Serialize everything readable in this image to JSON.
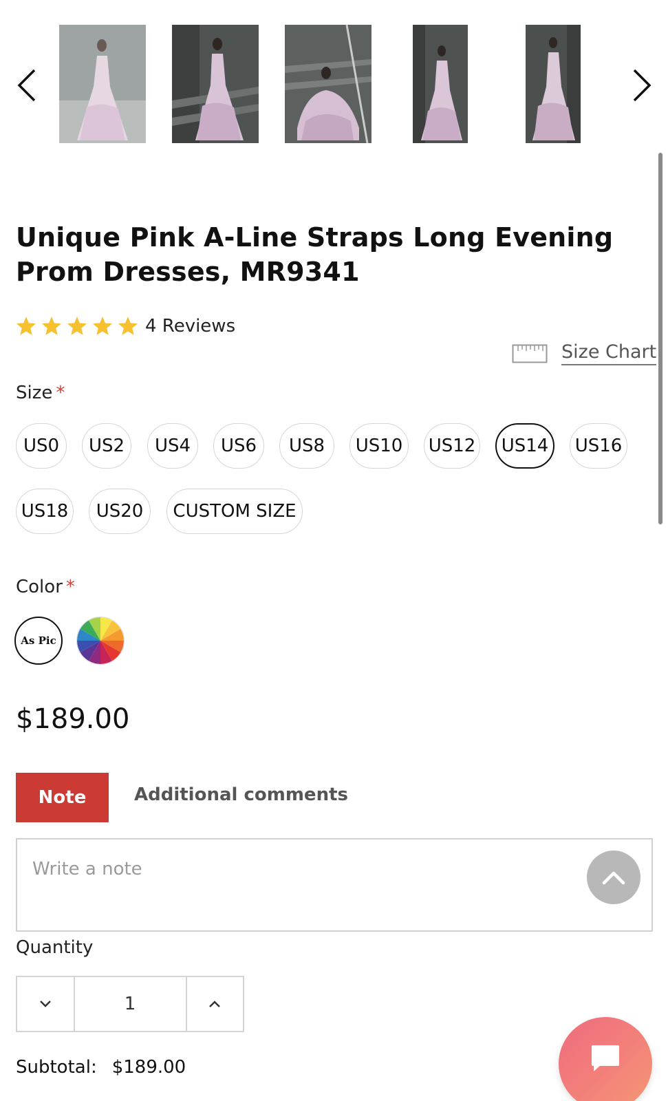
{
  "carousel": {
    "prev_icon": "chevron-left-icon",
    "next_icon": "chevron-right-icon",
    "thumbnails": [
      "dress-photo-1",
      "dress-photo-2",
      "dress-photo-3",
      "dress-photo-4",
      "dress-photo-5"
    ]
  },
  "product": {
    "title": "Unique Pink A-Line Straps Long Evening Prom Dresses, MR9341",
    "rating_stars": 5,
    "reviews_label": "4 Reviews",
    "size_chart_label": "Size Chart",
    "price": "$189.00"
  },
  "size": {
    "label": "Size",
    "required_mark": "*",
    "options": [
      "US0",
      "US2",
      "US4",
      "US6",
      "US8",
      "US10",
      "US12",
      "US14",
      "US16",
      "US18",
      "US20",
      "CUSTOM SIZE"
    ],
    "selected": "US14"
  },
  "color": {
    "label": "Color",
    "required_mark": "*",
    "options": [
      {
        "text": "As Pic",
        "icon": "as-pic-swatch"
      },
      {
        "text": "",
        "icon": "multicolor-wheel-swatch"
      }
    ],
    "selected": "As Pic"
  },
  "note": {
    "tab_label": "Note",
    "comments_label": "Additional comments",
    "placeholder": "Write a note",
    "value": ""
  },
  "quantity": {
    "label": "Quantity",
    "value": "1"
  },
  "subtotal": {
    "label": "Subtotal:",
    "value": "$189.00"
  },
  "colors": {
    "accent": "#cc3a34",
    "star": "#f5c12e",
    "chat_gradient_start": "#ef6b7d",
    "chat_gradient_end": "#f29a72"
  }
}
